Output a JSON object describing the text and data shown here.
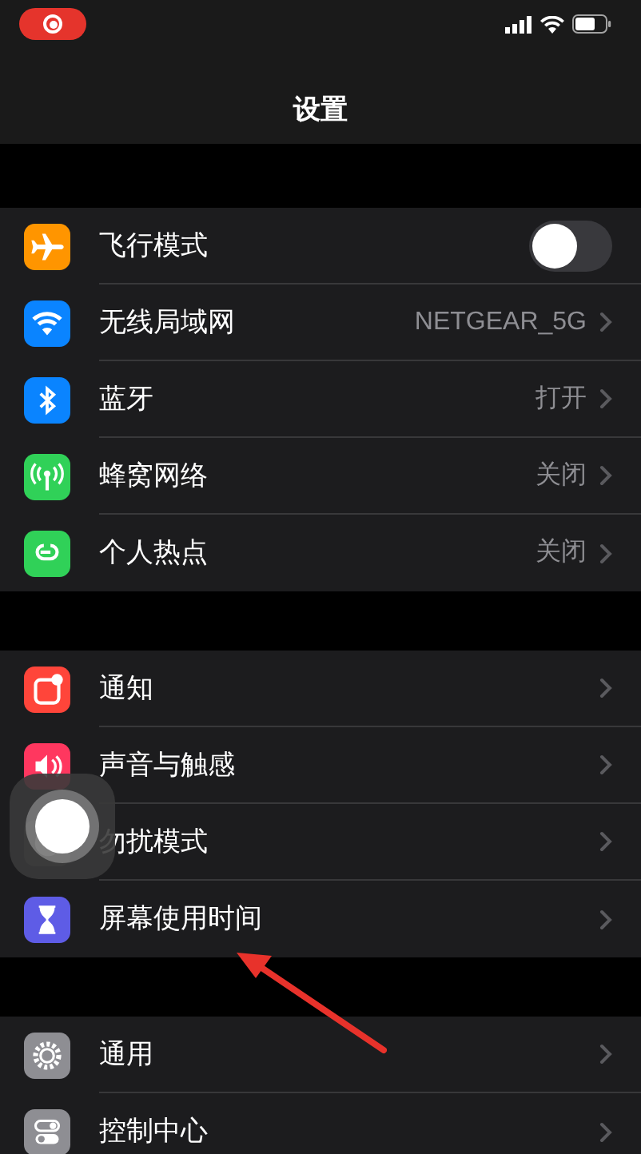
{
  "status_bar": {
    "recording": true
  },
  "title": "设置",
  "sections": [
    {
      "rows": [
        {
          "color": "#ff9500",
          "label": "飞行模式",
          "kind": "toggle",
          "on": false
        },
        {
          "color": "#0a84ff",
          "label": "无线局域网",
          "kind": "link",
          "value": "NETGEAR_5G"
        },
        {
          "color": "#0a84ff",
          "label": "蓝牙",
          "kind": "link",
          "value": "打开"
        },
        {
          "color": "#30d158",
          "label": "蜂窝网络",
          "kind": "link",
          "value": "关闭"
        },
        {
          "color": "#30d158",
          "label": "个人热点",
          "kind": "link",
          "value": "关闭"
        }
      ]
    },
    {
      "rows": [
        {
          "color": "#ff453a",
          "label": "通知",
          "kind": "link"
        },
        {
          "color": "#ff375f",
          "label": "声音与触感",
          "kind": "link"
        },
        {
          "label": "勿扰模式",
          "kind": "link"
        },
        {
          "color": "#5e5ce6",
          "label": "屏幕使用时间",
          "kind": "link"
        }
      ]
    },
    {
      "rows": [
        {
          "color": "#8e8e93",
          "label": "通用",
          "kind": "link"
        },
        {
          "color": "#8e8e93",
          "label": "控制中心",
          "kind": "link"
        }
      ]
    }
  ]
}
